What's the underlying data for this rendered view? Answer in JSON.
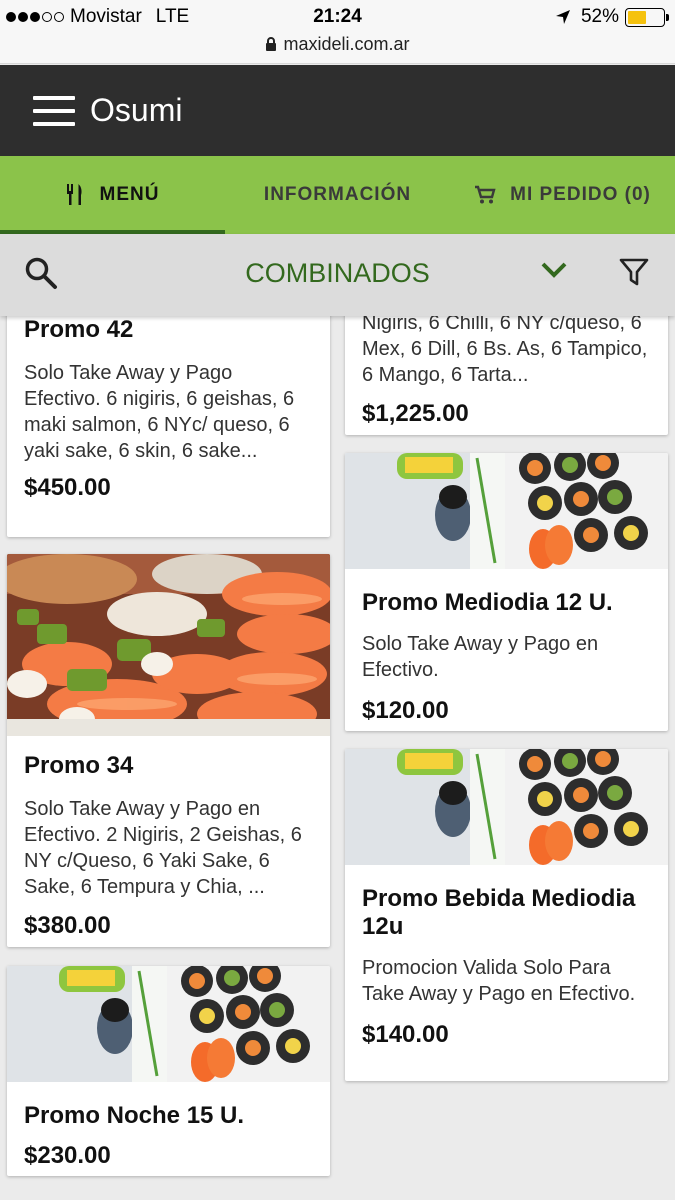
{
  "status": {
    "carrier": "Movistar",
    "network": "LTE",
    "time": "21:24",
    "battery": "52%",
    "url": "maxideli.com.ar"
  },
  "app": {
    "title": "Osumi"
  },
  "tabs": [
    {
      "label": "MENÚ",
      "icon": "fork-knife-icon"
    },
    {
      "label": "INFORMACIÓN"
    },
    {
      "label": "MI PEDIDO (0)",
      "icon": "cart-icon"
    }
  ],
  "category": {
    "title": "COMBINADOS"
  },
  "products": {
    "p42": {
      "title": "Promo 42",
      "desc": "Solo Take Away y Pago Efectivo. 6 nigiris, 6 geishas, 6 maki salmon, 6 NYc/ queso, 6 yaki sake, 6 skin, 6 sake...",
      "price": "$450.00"
    },
    "prev": {
      "desc": "Nigiris, 6 Chilli, 6 NY c/queso, 6 Mex, 6 Dill, 6 Bs. As, 6 Tampico, 6 Mango, 6 Tarta...",
      "price": "$1,225.00"
    },
    "p34": {
      "title": "Promo 34",
      "desc": "Solo Take Away y Pago en Efectivo. 2 Nigiris, 2 Geishas, 6 NY c/Queso, 6 Yaki Sake, 6 Sake, 6 Tempura y Chia, ...",
      "price": "$380.00"
    },
    "md12": {
      "title": "Promo Mediodia 12 U.",
      "desc": "Solo Take Away y Pago en Efectivo.",
      "price": "$120.00"
    },
    "bebida": {
      "title": "Promo Bebida Mediodia 12u",
      "desc": "Promocion Valida Solo Para Take Away y Pago en Efectivo.",
      "price": "$140.00"
    },
    "noche15": {
      "title": "Promo Noche 15 U.",
      "price": "$230.00"
    }
  }
}
